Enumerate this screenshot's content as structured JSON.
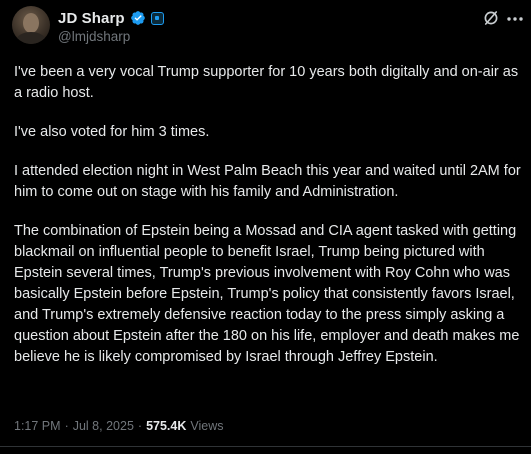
{
  "author": {
    "display_name": "JD Sharp",
    "handle": "@lmjdsharp",
    "verified": true,
    "avatar_icon": "profile-photo"
  },
  "header_actions": {
    "grok_icon": "grok-icon",
    "more_icon": "more-options-icon"
  },
  "post": {
    "paragraphs": [
      "I've been a very vocal Trump supporter for 10 years both digitally and on-air as a radio host.",
      "I've also voted for him 3 times.",
      "I attended election night in West Palm Beach this year and waited until 2AM for him to come out on stage with his family and Administration.",
      "The combination of Epstein being a Mossad and CIA agent tasked with getting blackmail on influential people to benefit Israel, Trump being pictured with Epstein several times, Trump's previous involvement with Roy Cohn who was basically Epstein before Epstein, Trump's policy that consistently favors Israel, and Trump's extremely defensive reaction today to the press simply asking a question about Epstein after the 180 on his life, employer and death makes me believe he is likely compromised by Israel through Jeffrey Epstein."
    ]
  },
  "meta": {
    "time": "1:17 PM",
    "separator": "·",
    "date": "Jul 8, 2025",
    "views_count": "575.4K",
    "views_label": "Views"
  },
  "colors": {
    "background": "#000000",
    "text": "#e7e9ea",
    "secondary_text": "#71767b",
    "accent": "#1d9bf0"
  }
}
